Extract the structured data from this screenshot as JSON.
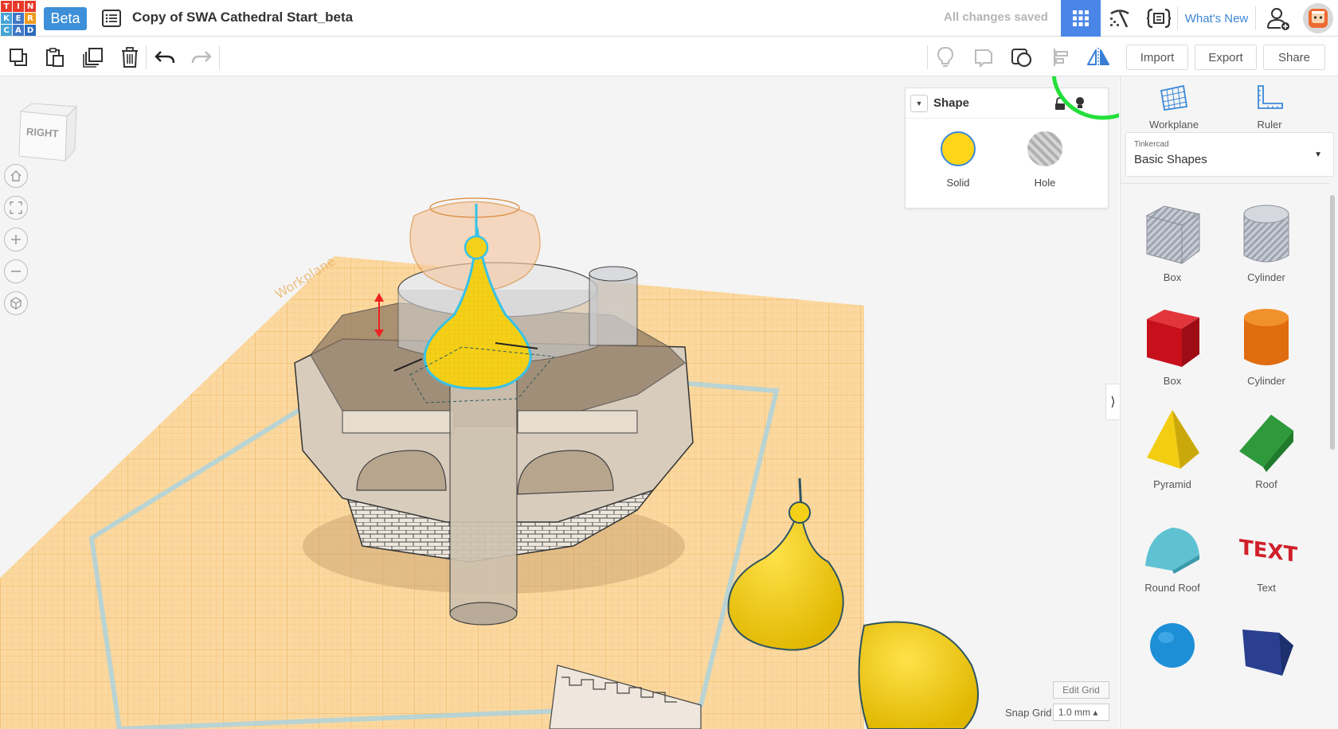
{
  "logo": {
    "letters": [
      "T",
      "I",
      "N",
      "K",
      "E",
      "R",
      "C",
      "A",
      "D"
    ],
    "colors": [
      "#e6392a",
      "#e6392a",
      "#e6392a",
      "#47a3d6",
      "#3f77c6",
      "#f29a1e",
      "#47a3d6",
      "#3f77c6",
      "#2c6bbd"
    ]
  },
  "header": {
    "beta_label": "Beta",
    "design_title": "Copy of SWA Cathedral Start_beta",
    "save_status": "All changes saved",
    "whats_new_label": "What's New"
  },
  "toolbar": {
    "import_label": "Import",
    "export_label": "Export",
    "share_label": "Share"
  },
  "viewcube": {
    "face_label": "RIGHT"
  },
  "inspector": {
    "title": "Shape",
    "solid_label": "Solid",
    "hole_label": "Hole",
    "solid_color": "#ffd51a"
  },
  "grid_controls": {
    "edit_grid_label": "Edit Grid",
    "snap_label": "Snap Grid",
    "snap_value": "1.0 mm ▴"
  },
  "right_panel": {
    "workplane_label": "Workplane",
    "ruler_label": "Ruler",
    "library_provider": "Tinkercad",
    "library_name": "Basic Shapes",
    "shapes": [
      {
        "name": "Box"
      },
      {
        "name": "Cylinder"
      },
      {
        "name": "Box"
      },
      {
        "name": "Cylinder"
      },
      {
        "name": "Pyramid"
      },
      {
        "name": "Roof"
      },
      {
        "name": "Round Roof"
      },
      {
        "name": "Text"
      }
    ]
  },
  "colors": {
    "accent_blue": "#4a86e8",
    "link_blue": "#3d86d8",
    "workplane_orange": "#f7c27a",
    "annotation_green": "#22e03a"
  }
}
